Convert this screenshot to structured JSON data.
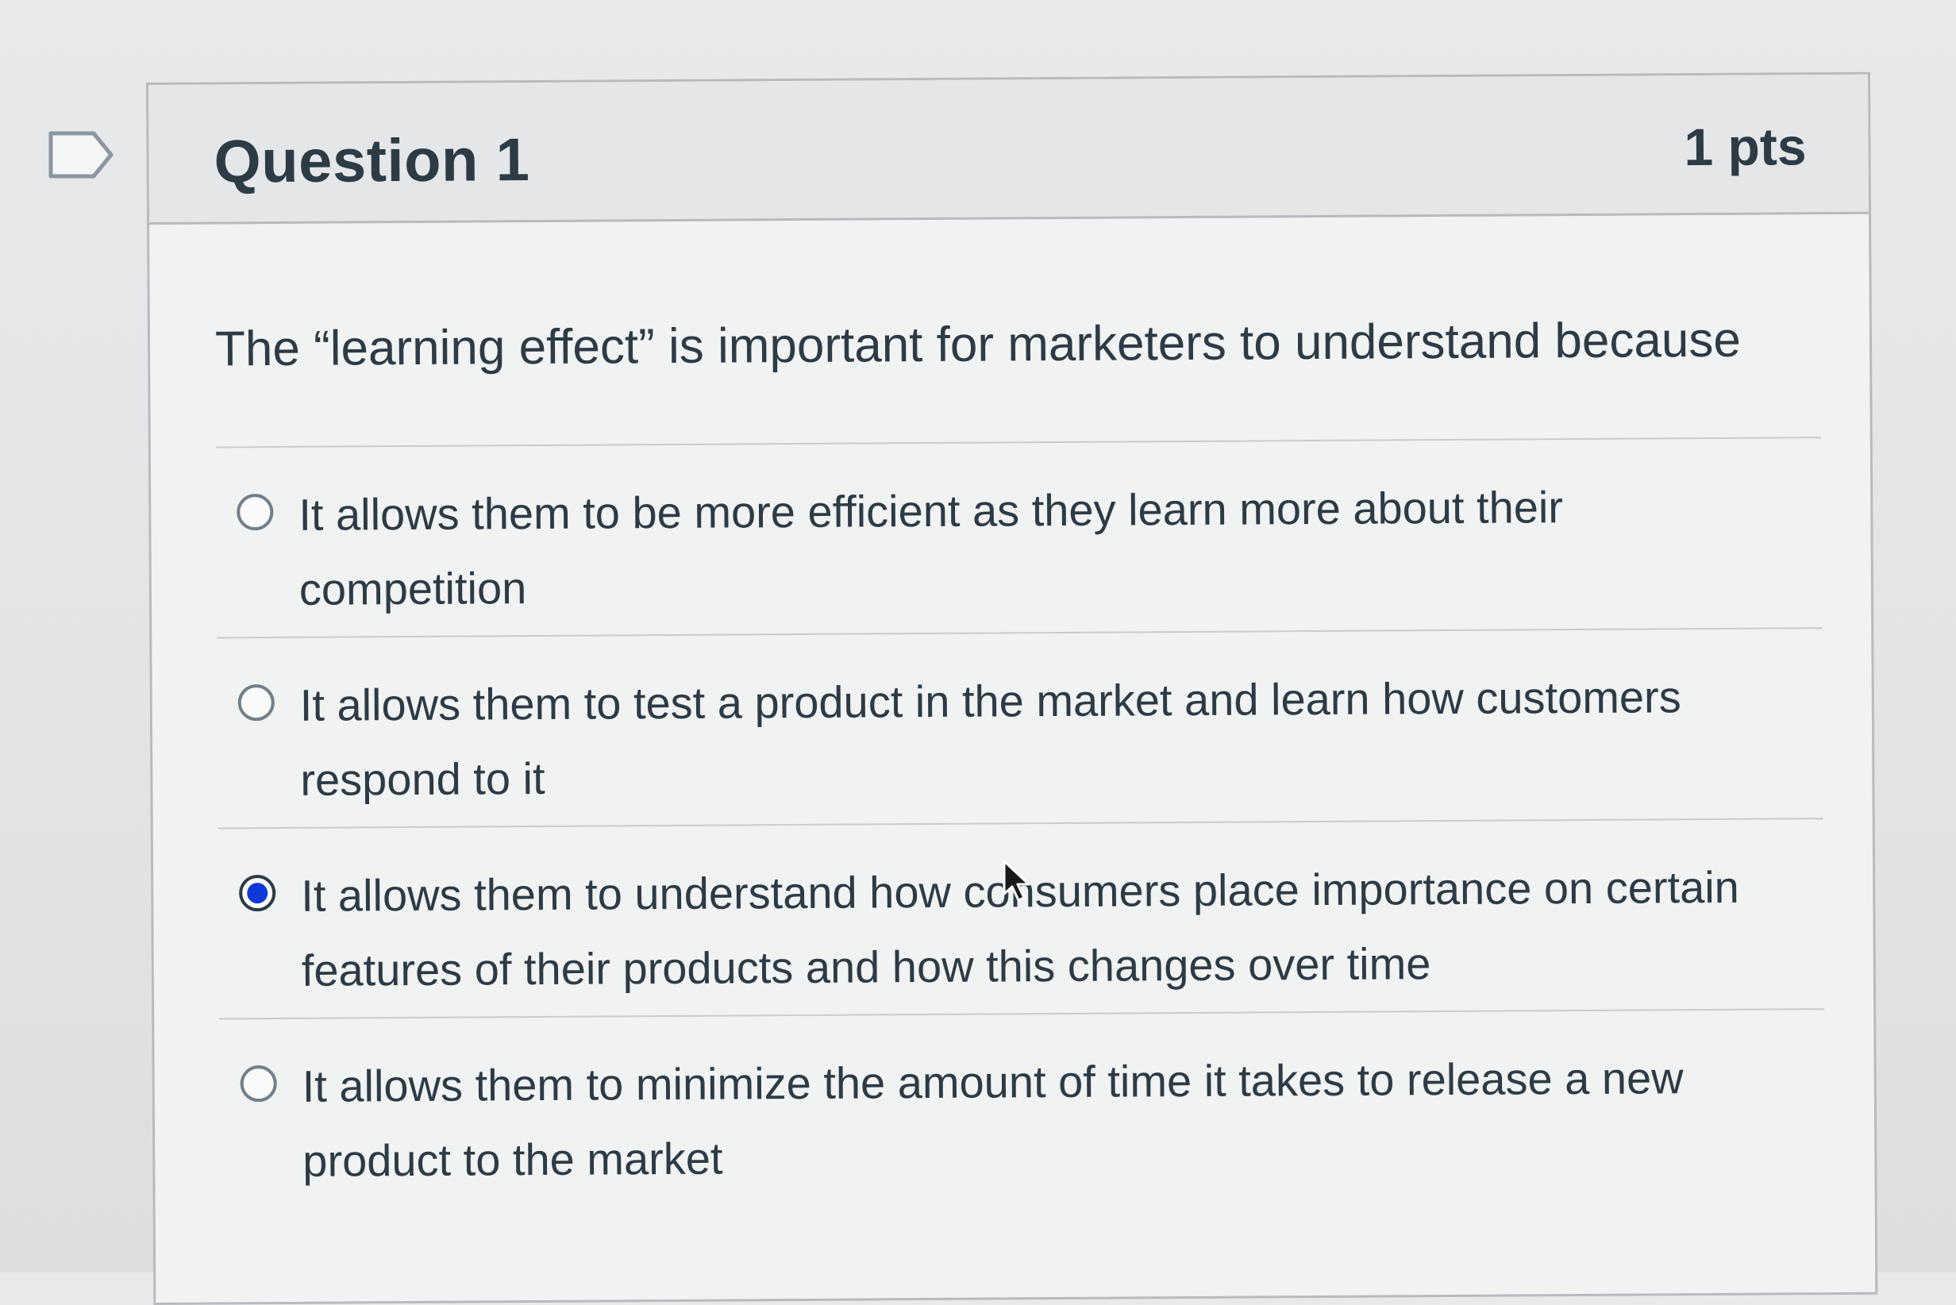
{
  "question": {
    "title": "Question 1",
    "points": "1 pts",
    "text": "The “learning effect” is important for marketers to understand because"
  },
  "answers": [
    {
      "label": "It allows them to be more efficient as they learn more about their competition",
      "selected": false
    },
    {
      "label": "It allows them to test a product in the market and learn how customers respond to it",
      "selected": false
    },
    {
      "label": "It allows them to understand how consumers place importance on certain features of their products and how this changes over time",
      "selected": true
    },
    {
      "label": "It allows them to minimize the amount of time it takes to release a new product to the market",
      "selected": false
    }
  ],
  "icons": {
    "flag": "flag-outline-icon",
    "cursor": "mouse-pointer-icon"
  },
  "colors": {
    "selected_radio": "#0f3ad9",
    "text": "#2d3b45"
  }
}
